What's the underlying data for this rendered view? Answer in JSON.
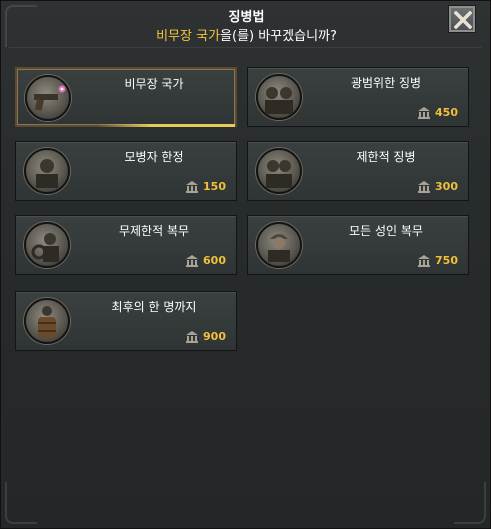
{
  "dialog": {
    "title": "징병법",
    "question_highlight": "비무장 국가",
    "question_rest": "을(를) 바꾸겠습니까?"
  },
  "laws": [
    {
      "id": "disarmed",
      "label": "비무장 국가",
      "cost": "",
      "selected": true,
      "icon": "pistol-icon"
    },
    {
      "id": "volunteer",
      "label": "광범위한 징병",
      "cost": "450",
      "selected": false,
      "icon": "soldiers-portrait-icon"
    },
    {
      "id": "limited",
      "label": "모병자 한정",
      "cost": "150",
      "selected": false,
      "icon": "soldier-portrait-icon"
    },
    {
      "id": "limited-conscription",
      "label": "제한적 징병",
      "cost": "300",
      "selected": false,
      "icon": "soldiers-portrait-icon"
    },
    {
      "id": "unlimited",
      "label": "무제한적 복무",
      "cost": "600",
      "selected": false,
      "icon": "soldier-portrait-icon"
    },
    {
      "id": "all-adults",
      "label": "모든 성인 복무",
      "cost": "750",
      "selected": false,
      "icon": "old-soldier-portrait-icon"
    },
    {
      "id": "scraping-barrel",
      "label": "최후의 한 명까지",
      "cost": "900",
      "selected": false,
      "icon": "barrel-soldier-portrait-icon"
    }
  ],
  "colors": {
    "highlight": "#f3c53c",
    "cost": "#f0c03a"
  }
}
